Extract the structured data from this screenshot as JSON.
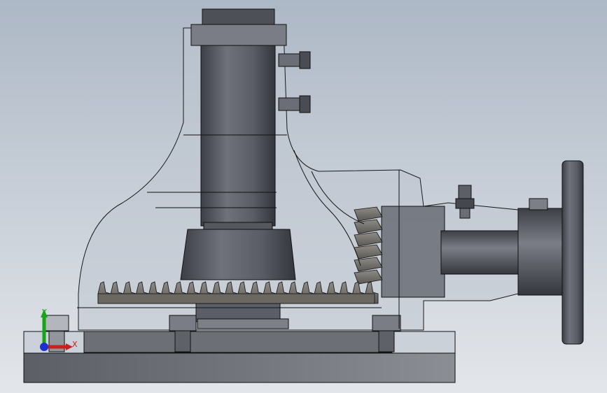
{
  "viewport": {
    "background_top": "#adb8c6",
    "background_bottom": "#e3e6ea"
  },
  "triad": {
    "x_label": "X",
    "y_label": "Y",
    "x_color": "#c8201e",
    "y_color": "#17a41b",
    "z_color": "#1c2fd0"
  },
  "model": {
    "body_fill": "#bcc3cc",
    "metal_dark": "#4b4d55",
    "metal_mid": "#6d7079",
    "metal_light": "#9ea1a8",
    "edge_color": "#111111"
  }
}
